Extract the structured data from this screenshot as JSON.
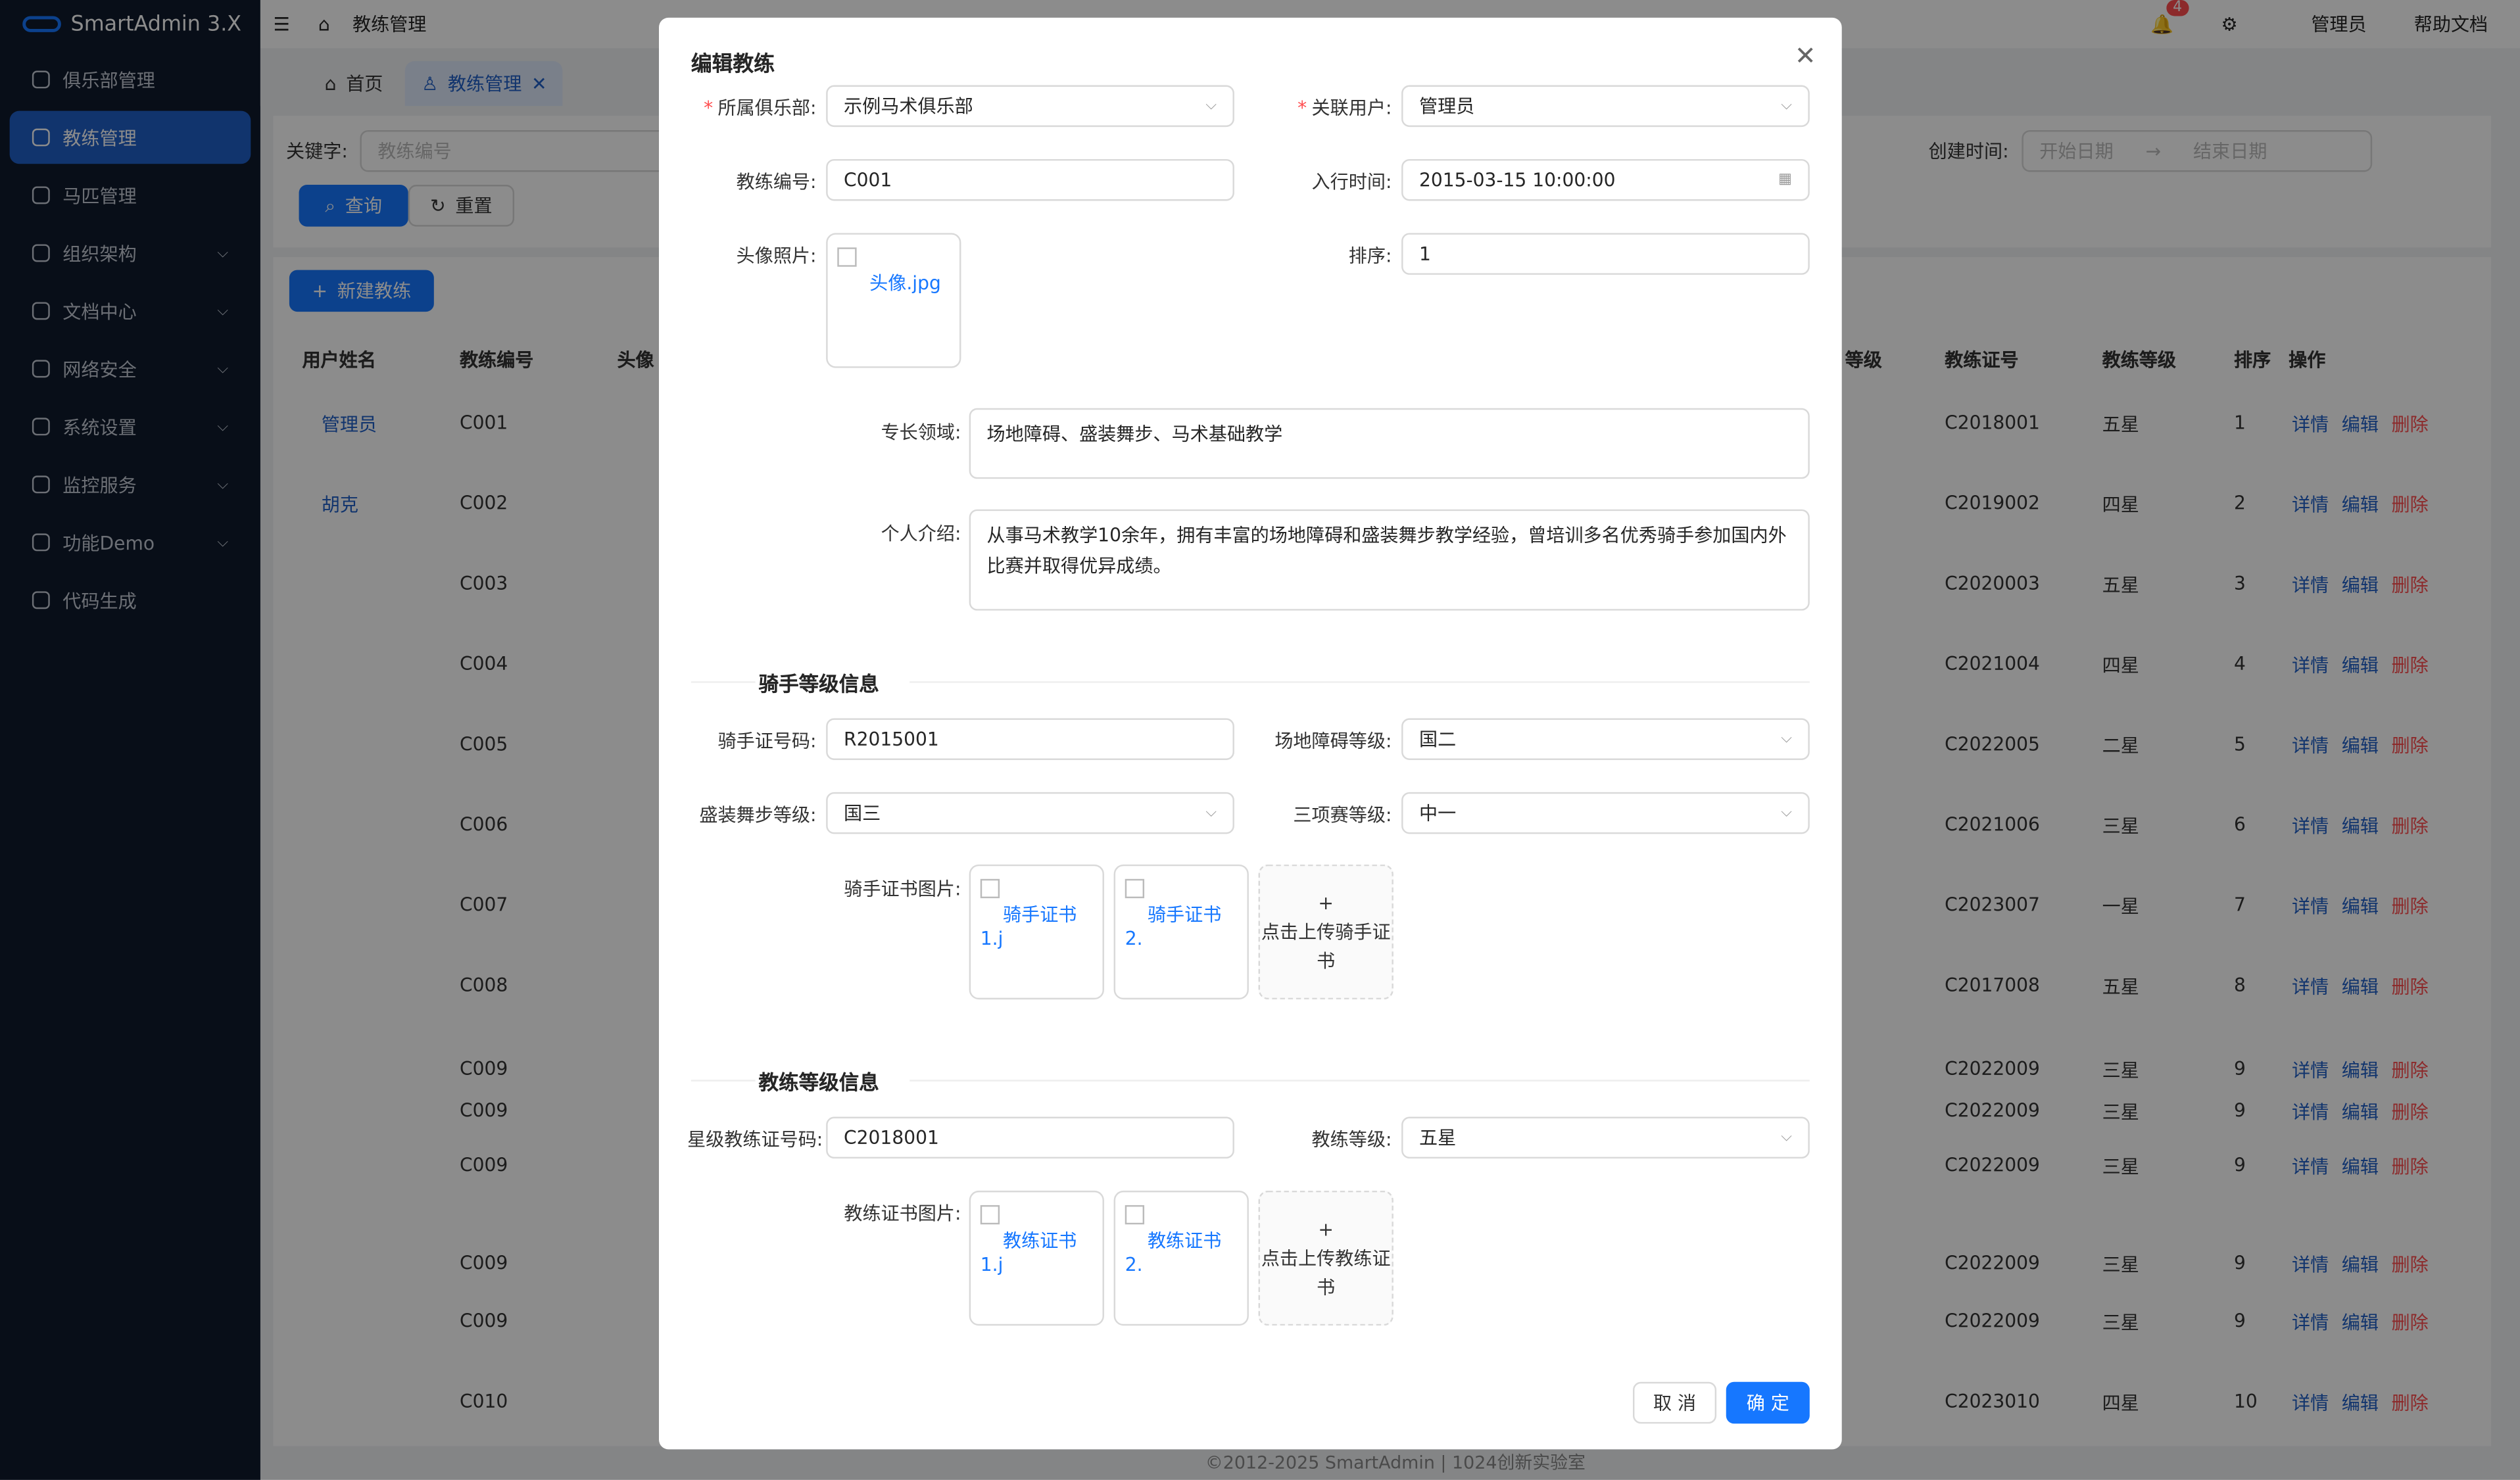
{
  "app": {
    "title": "SmartAdmin 3.X"
  },
  "sidebar": {
    "items": [
      {
        "label": "俱乐部管理"
      },
      {
        "label": "教练管理"
      },
      {
        "label": "马匹管理"
      },
      {
        "label": "组织架构"
      },
      {
        "label": "文档中心"
      },
      {
        "label": "网络安全"
      },
      {
        "label": "系统设置"
      },
      {
        "label": "监控服务"
      },
      {
        "label": "功能Demo"
      },
      {
        "label": "代码生成"
      }
    ]
  },
  "header": {
    "page": "教练管理",
    "notif_count": "4",
    "user": "管理员",
    "help": "帮助文档"
  },
  "tabs": [
    {
      "label": "首页"
    },
    {
      "label": "教练管理"
    }
  ],
  "search": {
    "keyword_label": "关键字:",
    "keyword_placeholder": "教练编号",
    "created_label": "创建时间:",
    "start_placeholder": "开始日期",
    "end_placeholder": "结束日期",
    "query_btn": "查询",
    "reset_btn": "重置"
  },
  "table": {
    "new_btn": "新建教练",
    "headers": {
      "name": "用户姓名",
      "code": "教练编号",
      "avatar": "头像",
      "grade": "等级",
      "cert": "教练证号",
      "level": "教练等级",
      "order": "排序",
      "ops": "操作"
    },
    "ops": {
      "detail": "详情",
      "edit": "编辑",
      "del": "删除"
    },
    "rows": [
      {
        "name": "管理员",
        "code": "C001",
        "cert": "C2018001",
        "level": "五星",
        "order": "1"
      },
      {
        "name": "胡克",
        "code": "C002",
        "cert": "C2019002",
        "level": "四星",
        "order": "2"
      },
      {
        "name": "",
        "code": "C003",
        "cert": "C2020003",
        "level": "五星",
        "order": "3"
      },
      {
        "name": "",
        "code": "C004",
        "cert": "C2021004",
        "level": "四星",
        "order": "4"
      },
      {
        "name": "",
        "code": "C005",
        "cert": "C2022005",
        "level": "二星",
        "order": "5"
      },
      {
        "name": "",
        "code": "C006",
        "cert": "C2021006",
        "level": "三星",
        "order": "6"
      },
      {
        "name": "",
        "code": "C007",
        "cert": "C2023007",
        "level": "一星",
        "order": "7"
      },
      {
        "name": "",
        "code": "C008",
        "cert": "C2017008",
        "level": "五星",
        "order": "8"
      },
      {
        "name": "",
        "code": "C009",
        "cert": "C2022009",
        "level": "三星",
        "order": "9"
      },
      {
        "name": "",
        "code": "C009",
        "cert": "C2022009",
        "level": "三星",
        "order": "9"
      },
      {
        "name": "",
        "code": "C009",
        "cert": "C2022009",
        "level": "三星",
        "order": "9"
      },
      {
        "name": "",
        "code": "C009",
        "cert": "C2022009",
        "level": "三星",
        "order": "9"
      },
      {
        "name": "",
        "code": "C009",
        "cert": "C2022009",
        "level": "三星",
        "order": "9"
      },
      {
        "name": "",
        "code": "C010",
        "cert": "C2023010",
        "level": "四星",
        "order": "10"
      }
    ]
  },
  "footer": "©2012-2025 SmartAdmin | 1024创新实验室",
  "modal": {
    "title": "编辑教练",
    "club_label": "所属俱乐部:",
    "club_value": "示例马术俱乐部",
    "user_label": "关联用户:",
    "user_value": "管理员",
    "code_label": "教练编号:",
    "code_value": "C001",
    "join_label": "入行时间:",
    "join_value": "2015-03-15 10:00:00",
    "avatar_label": "头像照片:",
    "avatar_file": "头像.jpg",
    "order_label": "排序:",
    "order_value": "1",
    "specialty_label": "专长领域:",
    "specialty_value": "场地障碍、盛装舞步、马术基础教学",
    "intro_label": "个人介绍:",
    "intro_value": "从事马术教学10余年，拥有丰富的场地障碍和盛装舞步教学经验，曾培训多名优秀骑手参加国内外比赛并取得优异成绩。",
    "rider_section": "骑手等级信息",
    "rider_no_label": "骑手证号码:",
    "rider_no_value": "R2015001",
    "jump_label": "场地障碍等级:",
    "jump_value": "国二",
    "dressage_label": "盛装舞步等级:",
    "dressage_value": "国三",
    "eventing_label": "三项赛等级:",
    "eventing_value": "中一",
    "rider_cert_label": "骑手证书图片:",
    "rider_cert_1": "骑手证书1.j",
    "rider_cert_2": "骑手证书2.",
    "rider_upload": "点击上传骑手证书",
    "coach_section": "教练等级信息",
    "star_no_label": "星级教练证号码:",
    "star_no_value": "C2018001",
    "coach_level_label": "教练等级:",
    "coach_level_value": "五星",
    "coach_cert_label": "教练证书图片:",
    "coach_cert_1": "教练证书1.j",
    "coach_cert_2": "教练证书2.",
    "coach_upload": "点击上传教练证书",
    "cancel": "取 消",
    "ok": "确 定"
  }
}
